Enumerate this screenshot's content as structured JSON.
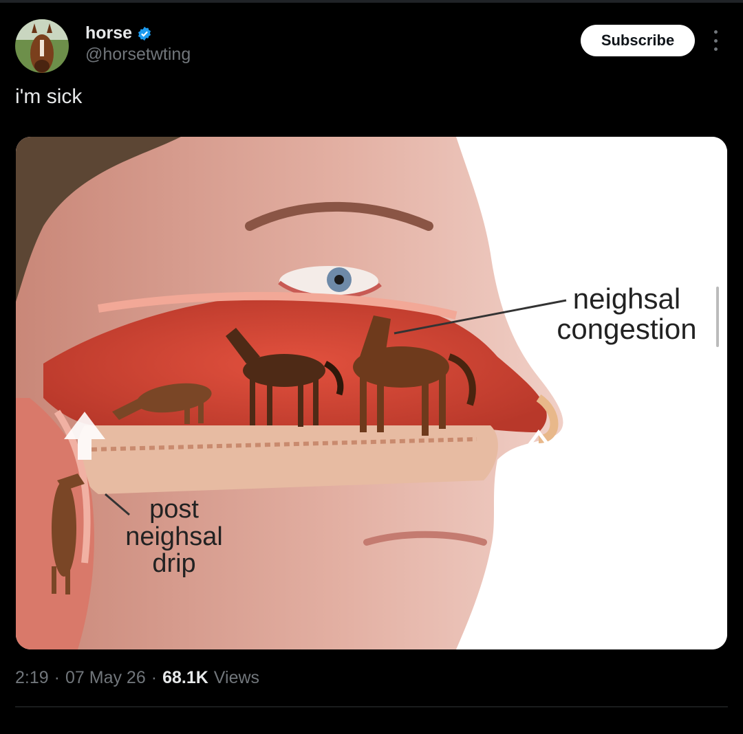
{
  "author": {
    "name": "horse",
    "handle": "@horsetwting",
    "verified": true
  },
  "actions": {
    "subscribe_label": "Subscribe"
  },
  "tweet": {
    "text": "i'm sick",
    "image_labels": {
      "congestion": "neighsal congestion",
      "drip": "post neighsal drip"
    },
    "time": "2:19",
    "date": "07 May 26",
    "views_count": "68.1K",
    "views_label": "Views"
  },
  "colors": {
    "background": "#000000",
    "verified_badge": "#1d9bf0",
    "secondary_text": "#71767b"
  }
}
